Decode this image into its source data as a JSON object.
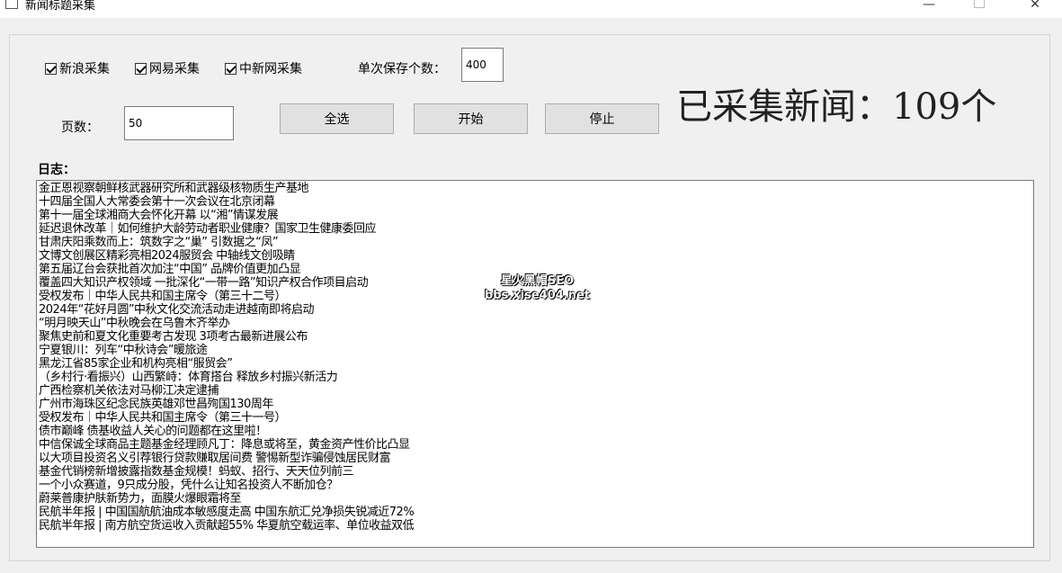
{
  "window": {
    "title": "新闻标题采集",
    "minimize_glyph": "—",
    "close_glyph": "✕"
  },
  "options": {
    "sina_label": "新浪采集",
    "netease_label": "网易采集",
    "chinanews_label": "中新网采集",
    "sina_checked": true,
    "netease_checked": true,
    "chinanews_checked": true,
    "save_count_label": "单次保存个数：",
    "save_count_value": "400",
    "pages_label": "页数：",
    "pages_value": "50"
  },
  "buttons": {
    "select_all": "全选",
    "start": "开始",
    "stop": "停止"
  },
  "status": {
    "collected_text": "已采集新闻：109个"
  },
  "log": {
    "label": "日志：",
    "lines": [
      "金正恩视察朝鲜核武器研究所和武器级核物质生产基地",
      "十四届全国人大常委会第十一次会议在北京闭幕",
      "第十一届全球湘商大会怀化开幕 以“湘”情谋发展",
      "延迟退休改革｜如何维护大龄劳动者职业健康？国家卫生健康委回应",
      "甘肃庆阳乘数而上：筑数字之“巢” 引数据之“凤”",
      "文博文创展区精彩亮相2024服贸会 中轴线文创吸睛",
      "第五届辽台会获批首次加注“中国” 品牌价值更加凸显",
      "覆盖四大知识产权领域 一批深化“一带一路”知识产权合作项目启动",
      "受权发布｜中华人民共和国主席令（第三十二号）",
      "2024年“花好月圆”中秋文化交流活动走进越南即将启动",
      "“明月映天山”中秋晚会在乌鲁木齐举办",
      "聚焦史前和夏文化重要考古发现 3项考古最新进展公布",
      "宁夏银川：列车“中秋诗会”暖旅途",
      "黑龙江省85家企业和机构亮相“服贸会”",
      "（乡村行·看振兴）山西繁峙：体育搭台 释放乡村振兴新活力",
      "广西检察机关依法对马柳江决定逮捕",
      "广州市海珠区纪念民族英雄邓世昌殉国130周年",
      "受权发布｜中华人民共和国主席令（第三十一号）",
      "债市巅峰 债基收益人关心的问题都在这里啦！",
      "中信保诚全球商品主题基金经理顾凡丁：降息或将至，黄金资产性价比凸显",
      "以大项目投资名义引荐银行贷款赚取居间费 警惕新型诈骗侵蚀居民财富",
      "基金代销榜新增披露指数基金规模！蚂蚁、招行、天天位列前三",
      "一个小众赛道，9只成分股，凭什么让知名投资人不断加仓？",
      "蔚莱普康护肤新势力，面膜火爆眼霜将至",
      "民航半年报 | 中国国航航油成本敏感度走高 中国东航汇兑净损失锐减近72%",
      "民航半年报 | 南方航空货运收入贡献超55% 华夏航空载运率、单位收益双低"
    ]
  },
  "watermark": {
    "line1": "星火黑帽SEO",
    "line2": "bbs.xise404.net"
  }
}
